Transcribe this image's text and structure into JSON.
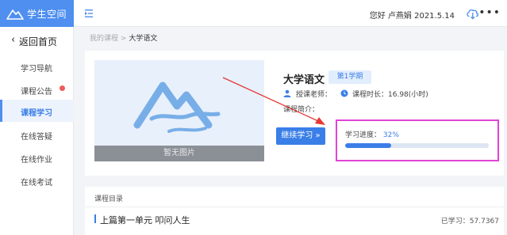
{
  "app": {
    "title": "学生空间",
    "greeting": "您好 卢燕娟 2021.5.14"
  },
  "sidebar": {
    "back_label": "返回首页",
    "items": [
      {
        "label": "学习导航"
      },
      {
        "label": "课程公告"
      },
      {
        "label": "课程学习"
      },
      {
        "label": "在线答疑"
      },
      {
        "label": "在线作业"
      },
      {
        "label": "在线考试"
      }
    ]
  },
  "breadcrumb": {
    "parent": "我的课程",
    "separator": ">",
    "current": "大学语文"
  },
  "course": {
    "cover_caption": "暂无图片",
    "title": "大学语文",
    "term": "第1学期",
    "teacher_label": "授课老师：",
    "duration_label": "课程时长：16.98(小时)",
    "intro_label": "课程简介：",
    "continue_label": "继续学习 »"
  },
  "progress": {
    "label": "学习进度：",
    "value_text": "32%",
    "value": 0.32
  },
  "catalog": {
    "title": "课程目录",
    "units": [
      {
        "title": "上篇第一单元 叩问人生",
        "studied": "已学习：57.7367"
      }
    ]
  },
  "colors": {
    "brand": "#4e8ff0",
    "accent": "#3a7ee8",
    "highlight_box": "#e044d6",
    "annotation_arrow": "#e53935",
    "badge": "#f05a5a"
  },
  "icons": {
    "logo": "mountain-logo-icon",
    "collapse": "collapse-menu-icon",
    "download": "cloud-download-icon",
    "more": "more-dots-icon",
    "back": "chevron-left-icon",
    "teacher": "person-icon",
    "duration": "clock-icon"
  }
}
